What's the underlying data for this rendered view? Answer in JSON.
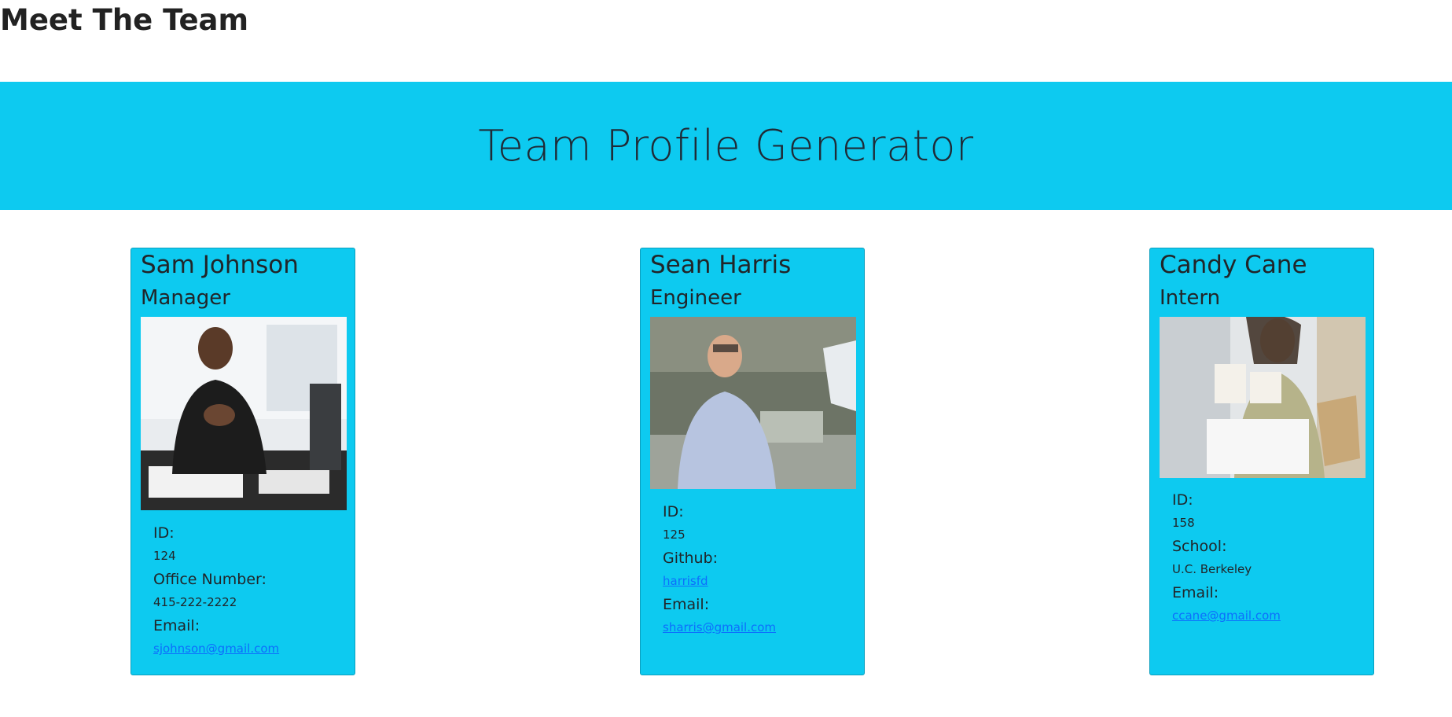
{
  "page": {
    "heading": "Meet The Team"
  },
  "banner": {
    "title": "Team Profile Generator",
    "color": "#0dcaf0"
  },
  "cards": [
    {
      "name": "Sam Johnson",
      "role": "Manager",
      "photo": "manager-photo",
      "fields": [
        {
          "label": "ID:",
          "value": "124"
        },
        {
          "label": "Office Number:",
          "value": "415-222-2222"
        },
        {
          "label": "Email:",
          "value": "sjohnson@gmail.com",
          "link": true
        }
      ]
    },
    {
      "name": "Sean Harris",
      "role": "Engineer",
      "photo": "engineer-photo",
      "fields": [
        {
          "label": "ID:",
          "value": "125"
        },
        {
          "label": "Github:",
          "value": "harrisfd",
          "link": true
        },
        {
          "label": "Email:",
          "value": "sharris@gmail.com",
          "link": true
        }
      ]
    },
    {
      "name": "Candy Cane",
      "role": "Intern",
      "photo": "intern-photo",
      "fields": [
        {
          "label": "ID:",
          "value": "158"
        },
        {
          "label": "School:",
          "value": "U.C. Berkeley"
        },
        {
          "label": "Email:",
          "value": "ccane@gmail.com",
          "link": true
        }
      ]
    }
  ],
  "colors": {
    "card_bg": "#0dcaf0",
    "link": "#0d6efd",
    "text": "#212529"
  }
}
